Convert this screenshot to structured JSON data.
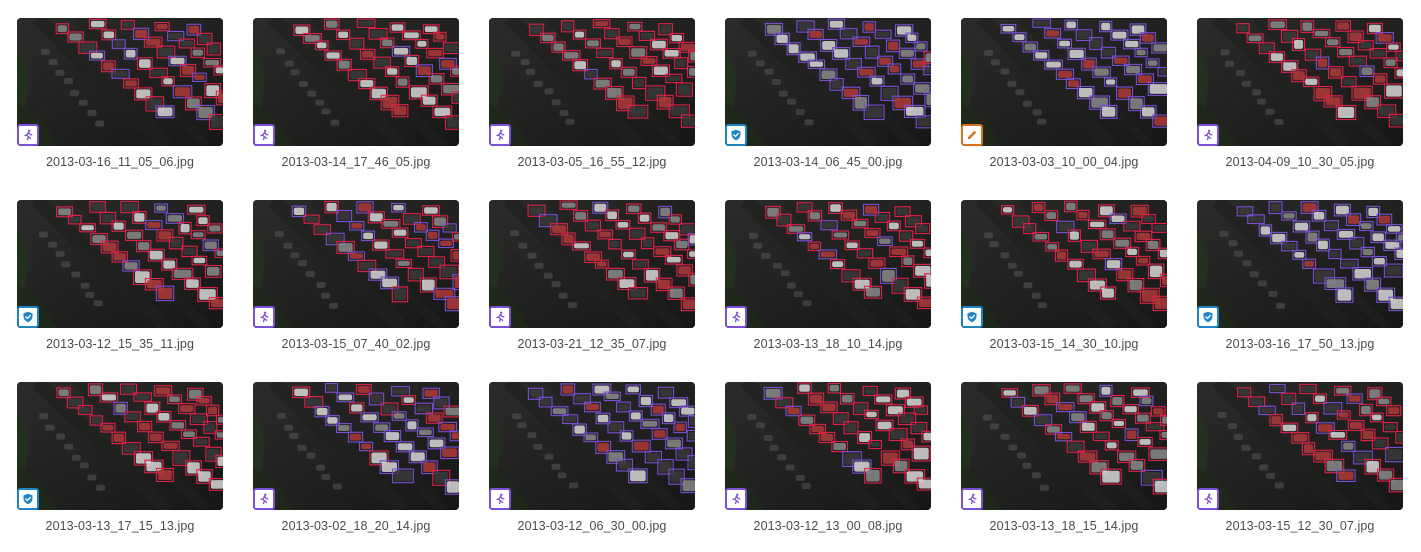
{
  "colors": {
    "annotation_purple": "#7b4fd8",
    "annotation_red": "#e0224a",
    "verified_blue": "#1f84c6",
    "edit_orange": "#d9731c"
  },
  "items": [
    {
      "filename": "2013-03-16_11_05_06.jpg",
      "status_icon": "running-person-icon",
      "scheme": "mixed"
    },
    {
      "filename": "2013-03-14_17_46_05.jpg",
      "status_icon": "running-person-icon",
      "scheme": "red"
    },
    {
      "filename": "2013-03-05_16_55_12.jpg",
      "status_icon": "running-person-icon",
      "scheme": "red"
    },
    {
      "filename": "2013-03-14_06_45_00.jpg",
      "status_icon": "shield-check-icon",
      "scheme": "purple-one-red"
    },
    {
      "filename": "2013-03-03_10_00_04.jpg",
      "status_icon": "pencil-icon",
      "scheme": "purple"
    },
    {
      "filename": "2013-04-09_10_30_05.jpg",
      "status_icon": "running-person-icon",
      "scheme": "red"
    },
    {
      "filename": "2013-03-12_15_35_11.jpg",
      "status_icon": "shield-check-icon",
      "scheme": "red"
    },
    {
      "filename": "2013-03-15_07_40_02.jpg",
      "status_icon": "running-person-icon",
      "scheme": "mixed"
    },
    {
      "filename": "2013-03-21_12_35_07.jpg",
      "status_icon": "running-person-icon",
      "scheme": "red"
    },
    {
      "filename": "2013-03-13_18_10_14.jpg",
      "status_icon": "running-person-icon",
      "scheme": "red"
    },
    {
      "filename": "2013-03-15_14_30_10.jpg",
      "status_icon": "shield-check-icon",
      "scheme": "red"
    },
    {
      "filename": "2013-03-16_17_50_13.jpg",
      "status_icon": "shield-check-icon",
      "scheme": "purple"
    },
    {
      "filename": "2013-03-13_17_15_13.jpg",
      "status_icon": "shield-check-icon",
      "scheme": "red"
    },
    {
      "filename": "2013-03-02_18_20_14.jpg",
      "status_icon": "running-person-icon",
      "scheme": "purple-mixed"
    },
    {
      "filename": "2013-03-12_06_30_00.jpg",
      "status_icon": "running-person-icon",
      "scheme": "purple"
    },
    {
      "filename": "2013-03-12_13_00_08.jpg",
      "status_icon": "running-person-icon",
      "scheme": "red"
    },
    {
      "filename": "2013-03-13_18_15_14.jpg",
      "status_icon": "running-person-icon",
      "scheme": "red-mixed"
    },
    {
      "filename": "2013-03-15_12_30_07.jpg",
      "status_icon": "running-person-icon",
      "scheme": "red-mixed"
    }
  ]
}
